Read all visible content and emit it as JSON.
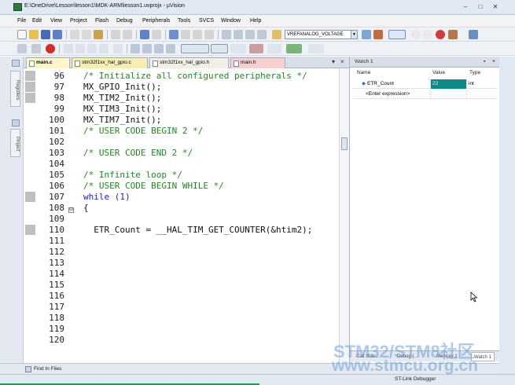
{
  "window": {
    "title": "E:\\OneDrive\\Lesson\\lesson1\\MDK-ARM\\lesson1.uvprojx - µVision",
    "minimize": "–",
    "maximize": "□",
    "close": "✕"
  },
  "menu": [
    "File",
    "Edit",
    "View",
    "Project",
    "Flash",
    "Debug",
    "Peripherals",
    "Tools",
    "SVCS",
    "Window",
    "Help"
  ],
  "toolbar": {
    "target_combo": "VREFANALOG_VOLTAGE"
  },
  "side_tabs": [
    "Registers",
    "Project"
  ],
  "editor": {
    "tabs": [
      {
        "label": "main.c",
        "active": true,
        "color": "#fff7c8"
      },
      {
        "label": "stm32f1xx_hal_gpio.c",
        "active": false,
        "color": "#f7efb0"
      },
      {
        "label": "stm32f1xx_hal_gpio.h",
        "active": false,
        "color": "#f2f0e6"
      },
      {
        "label": "main.h",
        "active": false,
        "color": "#f6d0d0"
      }
    ],
    "pin_icon": "▾",
    "close_icon": "×",
    "lines": [
      {
        "n": "96",
        "text": "/* Initialize all configured peripherals */",
        "kind": "comment",
        "bp": true
      },
      {
        "n": "97",
        "text": "MX_GPIO_Init();",
        "kind": "plain",
        "bp": true
      },
      {
        "n": "98",
        "text": "MX_TIM2_Init();",
        "kind": "plain",
        "bp": true
      },
      {
        "n": "99",
        "text": "MX_TIM3_Init();",
        "kind": "plain",
        "bp": false
      },
      {
        "n": "100",
        "text": "MX_TIM7_Init();",
        "kind": "plain",
        "bp": false
      },
      {
        "n": "101",
        "text": "/* USER CODE BEGIN 2 */",
        "kind": "comment",
        "bp": false
      },
      {
        "n": "102",
        "text": "",
        "kind": "plain",
        "bp": false
      },
      {
        "n": "103",
        "text": "/* USER CODE END 2 */",
        "kind": "comment",
        "bp": false
      },
      {
        "n": "104",
        "text": "",
        "kind": "plain",
        "bp": false
      },
      {
        "n": "105",
        "text": "/* Infinite loop */",
        "kind": "comment",
        "bp": false
      },
      {
        "n": "106",
        "text": "/* USER CODE BEGIN WHILE */",
        "kind": "comment",
        "bp": false
      },
      {
        "n": "107",
        "text": "while (1)",
        "kind": "kw",
        "bp": true
      },
      {
        "n": "108",
        "text": "{",
        "kind": "plain",
        "bp": false
      },
      {
        "n": "109",
        "text": "",
        "kind": "plain",
        "bp": false
      },
      {
        "n": "110",
        "text": "  ETR_Count = __HAL_TIM_GET_COUNTER(&htim2);",
        "kind": "plain",
        "bp": true
      },
      {
        "n": "111",
        "text": "",
        "kind": "plain",
        "bp": false
      },
      {
        "n": "112",
        "text": "",
        "kind": "plain",
        "bp": false
      },
      {
        "n": "113",
        "text": "",
        "kind": "plain",
        "bp": false
      },
      {
        "n": "114",
        "text": "",
        "kind": "plain",
        "bp": false
      },
      {
        "n": "115",
        "text": "",
        "kind": "plain",
        "bp": false
      },
      {
        "n": "116",
        "text": "",
        "kind": "plain",
        "bp": false
      },
      {
        "n": "117",
        "text": "",
        "kind": "plain",
        "bp": false
      },
      {
        "n": "118",
        "text": "",
        "kind": "plain",
        "bp": false
      },
      {
        "n": "119",
        "text": "",
        "kind": "plain",
        "bp": false
      },
      {
        "n": "120",
        "text": "",
        "kind": "plain",
        "bp": false
      }
    ],
    "fold_symbol": "⊟"
  },
  "watch": {
    "title": "Watch 1",
    "pin": "▪",
    "close": "×",
    "headers": {
      "name": "Name",
      "value": "Value",
      "type": "Type"
    },
    "rows": [
      {
        "name": "ETR_Count",
        "value": "22",
        "type": "int"
      },
      {
        "name": "<Enter expression>",
        "value": "",
        "type": ""
      }
    ],
    "bottom_tabs": [
      "Call Stac...",
      "Debug (...",
      "Memory 1",
      "Watch 1"
    ]
  },
  "bottom": {
    "find_tab": "Find In Files"
  },
  "status": {
    "debugger": "ST-Link Debugger"
  },
  "watermark": {
    "line1": "STM32/STM8社区",
    "line2": "www.stmcu.org.cn"
  }
}
